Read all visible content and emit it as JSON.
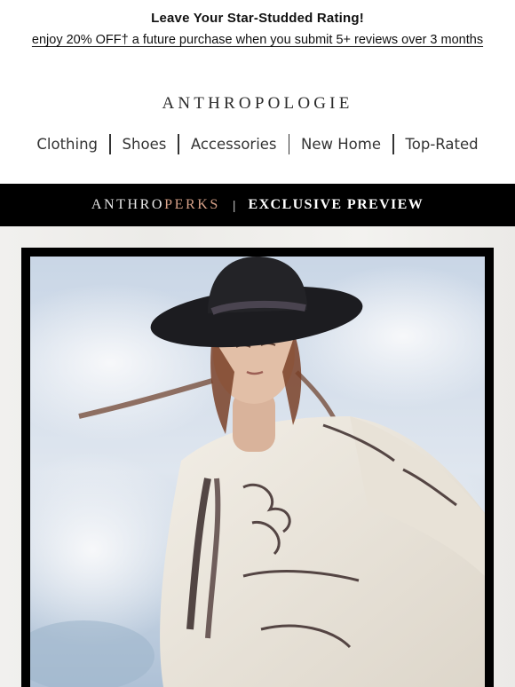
{
  "promo": {
    "title": "Leave Your Star-Studded Rating!",
    "link_text": "enjoy 20% OFF† a future purchase when you submit 5+ reviews over 3 months"
  },
  "brand": {
    "logo_text": "ANTHROPOLOGIE"
  },
  "nav": {
    "items": [
      "Clothing",
      "Shoes",
      "Accessories",
      "New Home",
      "Top-Rated"
    ]
  },
  "perks_bar": {
    "anthro": "ANTHRO",
    "perks": "PERKS",
    "separator": "|",
    "preview": "EXCLUSIVE PREVIEW"
  },
  "hero": {
    "image_icon": "photo-model-cowboy-hat"
  },
  "colors": {
    "bar_background": "#000000",
    "perks_accent": "#d9a38a",
    "text_dark": "#111111"
  }
}
